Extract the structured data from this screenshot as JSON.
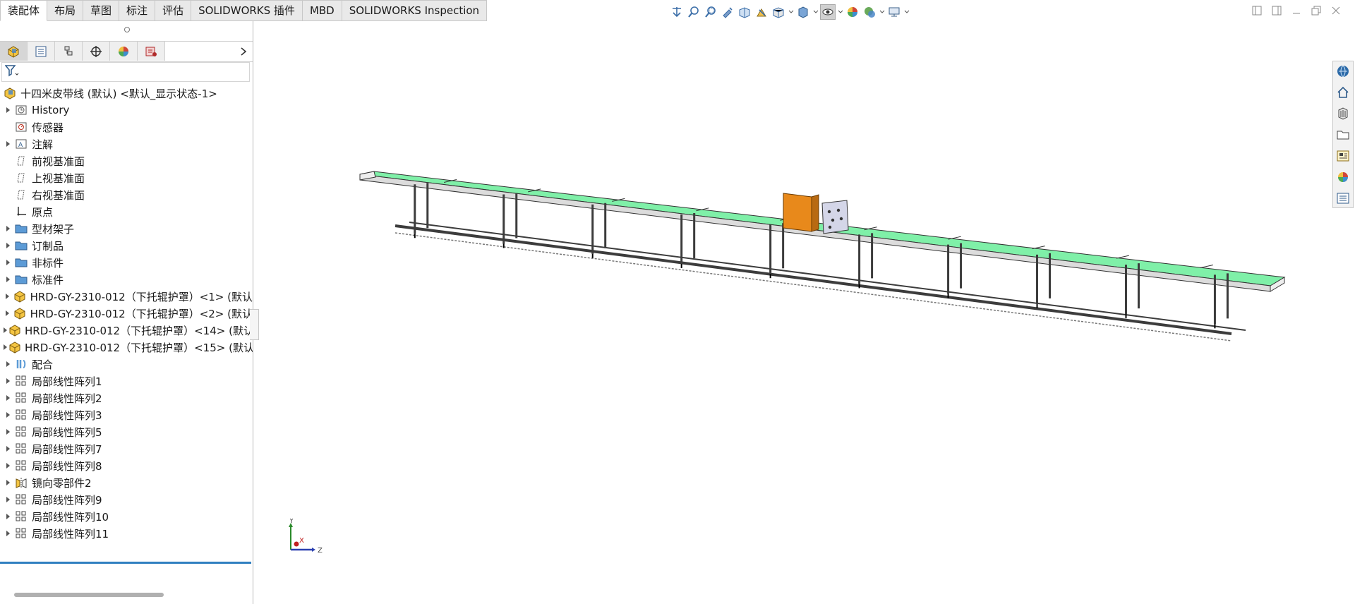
{
  "command_tabs": [
    "装配体",
    "布局",
    "草图",
    "标注",
    "评估",
    "SOLIDWORKS 插件",
    "MBD",
    "SOLIDWORKS Inspection"
  ],
  "active_tab_index": 0,
  "heads_up_toolbar": [
    "view-orientation-icon",
    "zoom-to-fit-icon",
    "zoom-to-area-icon",
    "previous-view-icon",
    "section-view-icon",
    "dynamic-annotation-icon",
    "view-settings-icon",
    "display-style-icon",
    "hide-show-icon",
    "edit-appearance-icon",
    "apply-scene-icon",
    "display-settings-icon"
  ],
  "manager_tabs": [
    "featuremanager-icon",
    "propertymanager-icon",
    "configurationmanager-icon",
    "dimxpert-icon",
    "display-manager-icon",
    "cam-icon"
  ],
  "tree": {
    "root": "十四米皮带线 (默认) <默认_显示状态-1>",
    "items": [
      {
        "label": "History",
        "icon": "history-icon",
        "expandable": true
      },
      {
        "label": "传感器",
        "icon": "sensor-icon",
        "expandable": false
      },
      {
        "label": "注解",
        "icon": "annotation-icon",
        "expandable": true
      },
      {
        "label": "前视基准面",
        "icon": "plane-icon",
        "expandable": false
      },
      {
        "label": "上视基准面",
        "icon": "plane-icon",
        "expandable": false
      },
      {
        "label": "右视基准面",
        "icon": "plane-icon",
        "expandable": false
      },
      {
        "label": "原点",
        "icon": "origin-icon",
        "expandable": false
      },
      {
        "label": "型材架子",
        "icon": "folder-icon",
        "expandable": true
      },
      {
        "label": "订制品",
        "icon": "folder-icon",
        "expandable": true
      },
      {
        "label": "非标件",
        "icon": "folder-icon",
        "expandable": true
      },
      {
        "label": "标准件",
        "icon": "folder-icon",
        "expandable": true
      },
      {
        "label": "HRD-GY-2310-012（下托辊护罩）<1> (默认",
        "icon": "part-icon",
        "expandable": true
      },
      {
        "label": "HRD-GY-2310-012（下托辊护罩）<2> (默认",
        "icon": "part-icon",
        "expandable": true
      },
      {
        "label": "HRD-GY-2310-012（下托辊护罩）<14> (默认",
        "icon": "part-icon",
        "expandable": true
      },
      {
        "label": "HRD-GY-2310-012（下托辊护罩）<15> (默认",
        "icon": "part-icon",
        "expandable": true
      },
      {
        "label": "配合",
        "icon": "mates-icon",
        "expandable": true
      },
      {
        "label": "局部线性阵列1",
        "icon": "pattern-icon",
        "expandable": true
      },
      {
        "label": "局部线性阵列2",
        "icon": "pattern-icon",
        "expandable": true
      },
      {
        "label": "局部线性阵列3",
        "icon": "pattern-icon",
        "expandable": true
      },
      {
        "label": "局部线性阵列5",
        "icon": "pattern-icon",
        "expandable": true
      },
      {
        "label": "局部线性阵列7",
        "icon": "pattern-icon",
        "expandable": true
      },
      {
        "label": "局部线性阵列8",
        "icon": "pattern-icon",
        "expandable": true
      },
      {
        "label": "镜向零部件2",
        "icon": "mirror-icon",
        "expandable": true
      },
      {
        "label": "局部线性阵列9",
        "icon": "pattern-icon",
        "expandable": true
      },
      {
        "label": "局部线性阵列10",
        "icon": "pattern-icon",
        "expandable": true
      },
      {
        "label": "局部线性阵列11",
        "icon": "pattern-icon",
        "expandable": true
      }
    ]
  },
  "task_pane": [
    "solidworks-resources-icon",
    "home-icon",
    "design-library-icon",
    "file-explorer-icon",
    "view-palette-icon",
    "appearances-icon",
    "custom-properties-icon"
  ],
  "triad": {
    "y": "Y",
    "x": "X",
    "z": "Z"
  },
  "colors": {
    "belt": "#7ff0a8",
    "frame": "#3c3c3c",
    "cabinet_orange": "#e8891b",
    "control_box": "#d4d6e8",
    "accent": "#2f7fc0"
  }
}
